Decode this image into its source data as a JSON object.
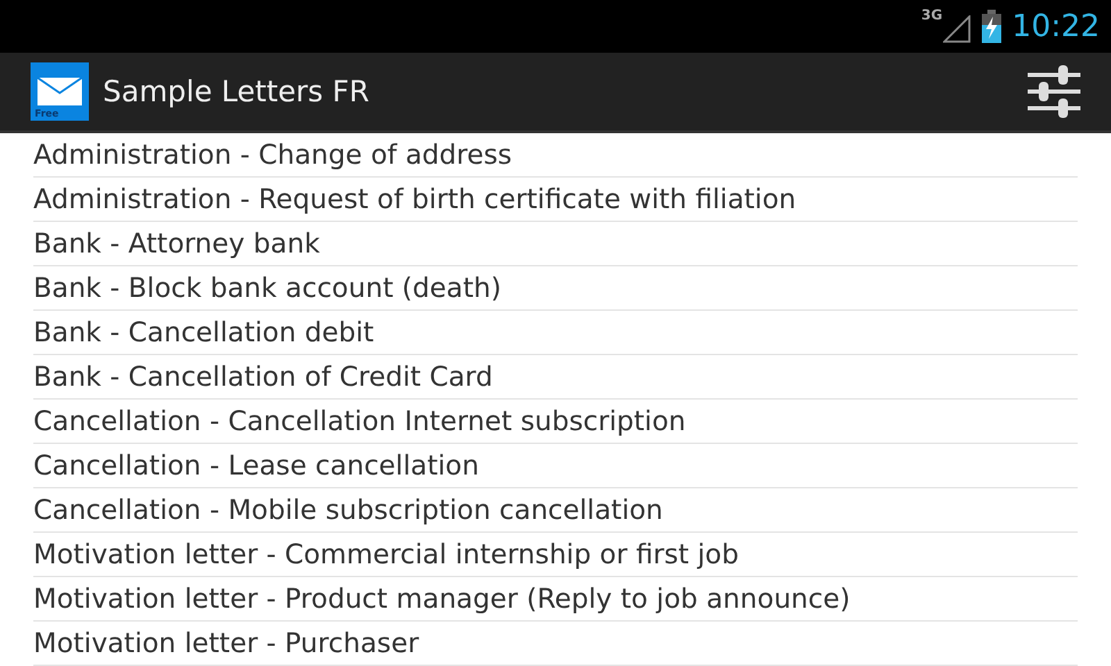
{
  "status_bar": {
    "network": "3G",
    "time": "10:22"
  },
  "action_bar": {
    "app_icon_badge": "Free",
    "title": "Sample Letters FR"
  },
  "letters": [
    {
      "title": "Administration - Change of address"
    },
    {
      "title": "Administration - Request of birth certificate with filiation"
    },
    {
      "title": "Bank - Attorney bank"
    },
    {
      "title": "Bank - Block bank account (death)"
    },
    {
      "title": "Bank - Cancellation debit"
    },
    {
      "title": "Bank - Cancellation of Credit Card"
    },
    {
      "title": "Cancellation - Cancellation Internet subscription"
    },
    {
      "title": "Cancellation - Lease cancellation"
    },
    {
      "title": "Cancellation - Mobile subscription cancellation"
    },
    {
      "title": "Motivation letter - Commercial internship or first job"
    },
    {
      "title": "Motivation letter - Product manager (Reply to job announce)"
    },
    {
      "title": "Motivation letter - Purchaser"
    }
  ]
}
